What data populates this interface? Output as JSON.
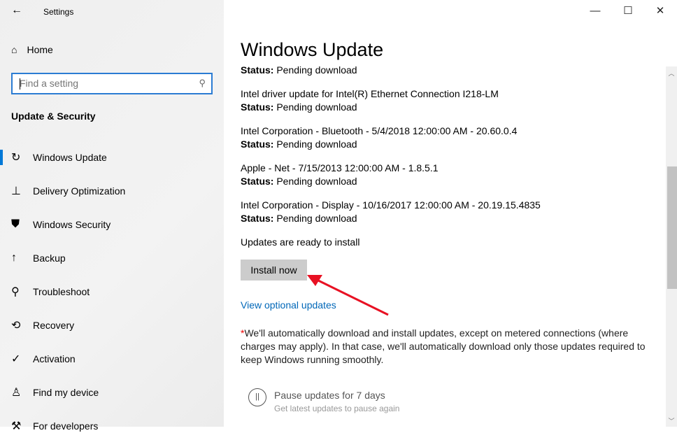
{
  "app": {
    "title": "Settings",
    "back_icon": "back-arrow-icon"
  },
  "sidebar": {
    "home": "Home",
    "search_placeholder": "Find a setting",
    "section": "Update & Security",
    "items": [
      {
        "label": "Windows Update",
        "icon": "↻"
      },
      {
        "label": "Delivery Optimization",
        "icon": "⊥"
      },
      {
        "label": "Windows Security",
        "icon": "⛊"
      },
      {
        "label": "Backup",
        "icon": "↑"
      },
      {
        "label": "Troubleshoot",
        "icon": "⚲"
      },
      {
        "label": "Recovery",
        "icon": "⟲"
      },
      {
        "label": "Activation",
        "icon": "✓"
      },
      {
        "label": "Find my device",
        "icon": "♙"
      },
      {
        "label": "For developers",
        "icon": "⚒"
      }
    ]
  },
  "main": {
    "title": "Windows Update",
    "status_label": "Status:",
    "updates": [
      {
        "name": "",
        "status": "Pending download"
      },
      {
        "name": "Intel driver update for Intel(R) Ethernet Connection I218-LM",
        "status": "Pending download"
      },
      {
        "name": "Intel Corporation - Bluetooth - 5/4/2018 12:00:00 AM - 20.60.0.4",
        "status": "Pending download"
      },
      {
        "name": "Apple - Net - 7/15/2013 12:00:00 AM - 1.8.5.1",
        "status": "Pending download"
      },
      {
        "name": "Intel Corporation - Display - 10/16/2017 12:00:00 AM - 20.19.15.4835",
        "status": "Pending download"
      }
    ],
    "ready": "Updates are ready to install",
    "install_button": "Install now",
    "optional_link": "View optional updates",
    "note_star": "*",
    "note": "We'll automatically download and install updates, except on metered connections (where charges may apply). In that case, we'll automatically download only those updates required to keep Windows running smoothly.",
    "pause_title": "Pause updates for 7 days",
    "pause_sub": "Get latest updates to pause again"
  },
  "colors": {
    "accent": "#0078d7",
    "link": "#0067b8",
    "arrow": "#e81123"
  }
}
